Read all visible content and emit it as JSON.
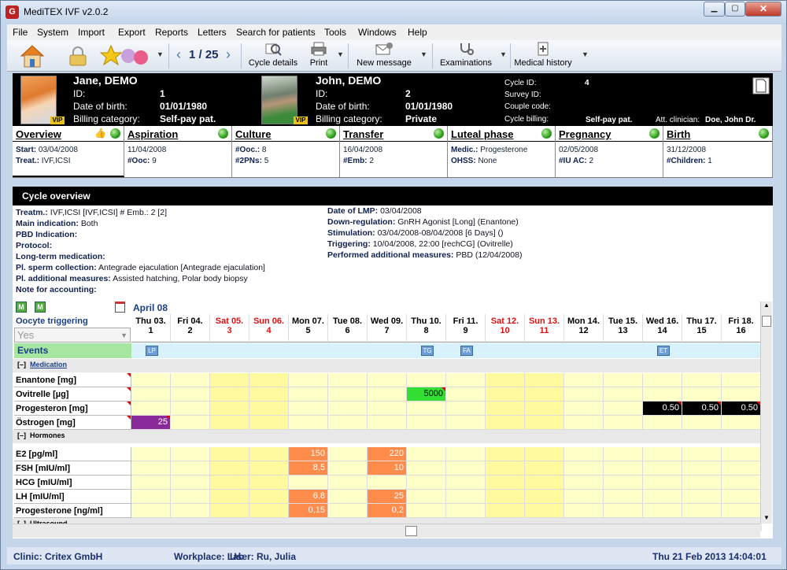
{
  "window": {
    "title": "MediTEX IVF v2.0.2",
    "app_icon_glyph": "G"
  },
  "menu": [
    "File",
    "System",
    "Import",
    "Export",
    "Reports",
    "Letters",
    "Search for patients",
    "Tools",
    "Windows",
    "Help"
  ],
  "toolbar": {
    "counter": "1 / 25",
    "cycle_details": "Cycle details",
    "print": "Print",
    "new_message": "New message",
    "examinations": "Examinations",
    "medical_history": "Medical history"
  },
  "patient": {
    "female": {
      "name": "Jane, DEMO",
      "id_label": "ID:",
      "id": "1",
      "dob_label": "Date of birth:",
      "dob": "01/01/1980",
      "billing_label": "Billing category:",
      "billing": "Self-pay pat.",
      "badge": "VIP"
    },
    "male": {
      "name": "John, DEMO",
      "id_label": "ID:",
      "id": "2",
      "dob_label": "Date of birth:",
      "dob": "01/01/1980",
      "billing_label": "Billing category:",
      "billing": "Private",
      "badge": "VIP"
    },
    "cycle_id_label": "Cycle ID:",
    "cycle_id": "4",
    "survey_id_label": "Survey ID:",
    "couple_code_label": "Couple code:",
    "cycle_billing_label": "Cycle billing:",
    "cycle_billing": "Self-pay pat.",
    "att_clinician_label": "Att. clinician:",
    "att_clinician": "Doe, John Dr."
  },
  "tabs": [
    {
      "title": "Overview",
      "l1k": "Start:",
      "l1v": "03/04/2008",
      "l2k": "Treat.:",
      "l2v": "IVF,ICSI"
    },
    {
      "title": "Aspiration",
      "l1k": "",
      "l1v": "11/04/2008",
      "l2k": "#Ooc:",
      "l2v": "9"
    },
    {
      "title": "Culture",
      "l1k": "#Ooc.:",
      "l1v": "8",
      "l2k": "#2PNs:",
      "l2v": "5"
    },
    {
      "title": "Transfer",
      "l1k": "",
      "l1v": "16/04/2008",
      "l2k": "#Emb:",
      "l2v": "2"
    },
    {
      "title": "Luteal phase",
      "l1k": "Medic.:",
      "l1v": "Progesterone",
      "l2k": "OHSS:",
      "l2v": "None"
    },
    {
      "title": "Pregnancy",
      "l1k": "",
      "l1v": "02/05/2008",
      "l2k": "#IU AC:",
      "l2v": "2"
    },
    {
      "title": "Birth",
      "l1k": "",
      "l1v": "31/12/2008",
      "l2k": "#Children:",
      "l2v": "1"
    }
  ],
  "cycle_overview": {
    "title": "Cycle overview",
    "left": [
      {
        "k": "Treatm.:",
        "v": "IVF,ICSI     [IVF,ICSI]      # Emb.:  2     [2]"
      },
      {
        "k": "Main indication:",
        "v": "Both"
      },
      {
        "k": "PBD Indication:",
        "v": ""
      },
      {
        "k": "Protocol:",
        "v": ""
      },
      {
        "k": "Long-term medication:",
        "v": ""
      },
      {
        "k": "Pl. sperm collection:",
        "v": "Antegrade ejaculation       [Antegrade ejaculation]"
      },
      {
        "k": "Pl. additional measures:",
        "v": "Assisted hatching, Polar body biopsy"
      },
      {
        "k": "Note for accounting:",
        "v": ""
      }
    ],
    "right": [
      {
        "k": "Date of LMP:",
        "v": "03/04/2008"
      },
      {
        "k": "Down-regulation:",
        "v": "GnRH Agonist [Long] (Enantone)"
      },
      {
        "k": "Stimulation:",
        "v": "03/04/2008-08/04/2008 [6 Days]  ()"
      },
      {
        "k": "Triggering:",
        "v": "10/04/2008, 22:00  [rechCG] (Ovitrelle)"
      },
      {
        "k": "Performed additional measures:",
        "v": "PBD (12/04/2008)"
      }
    ]
  },
  "calendar": {
    "month": "April 08",
    "oocyte_triggering_label": "Oocyte triggering",
    "oocyte_triggering_value": "Yes",
    "events_label": "Events",
    "days": [
      {
        "d": "Thu 03.",
        "n": "1",
        "we": false
      },
      {
        "d": "Fri 04.",
        "n": "2",
        "we": false
      },
      {
        "d": "Sat 05.",
        "n": "3",
        "we": true
      },
      {
        "d": "Sun 06.",
        "n": "4",
        "we": true
      },
      {
        "d": "Mon 07.",
        "n": "5",
        "we": false
      },
      {
        "d": "Tue 08.",
        "n": "6",
        "we": false
      },
      {
        "d": "Wed 09.",
        "n": "7",
        "we": false
      },
      {
        "d": "Thu 10.",
        "n": "8",
        "we": false
      },
      {
        "d": "Fri 11.",
        "n": "9",
        "we": false
      },
      {
        "d": "Sat 12.",
        "n": "10",
        "we": true
      },
      {
        "d": "Sun 13.",
        "n": "11",
        "we": true
      },
      {
        "d": "Mon 14.",
        "n": "12",
        "we": false
      },
      {
        "d": "Tue 15.",
        "n": "13",
        "we": false
      },
      {
        "d": "Wed 16.",
        "n": "14",
        "we": false
      },
      {
        "d": "Thu 17.",
        "n": "15",
        "we": false
      },
      {
        "d": "Fri 18.",
        "n": "16",
        "we": false
      }
    ],
    "events": [
      {
        "col": 0,
        "tag": "LP"
      },
      {
        "col": 7,
        "tag": "TG"
      },
      {
        "col": 8,
        "tag": "FA"
      },
      {
        "col": 13,
        "tag": "ET"
      }
    ],
    "medication_section": "Medication",
    "medication_rows": [
      {
        "label": "Enantone [mg]",
        "cells": []
      },
      {
        "label": "Ovitrelle [µg]",
        "cells": [
          {
            "col": 7,
            "v": "5000",
            "style": "green"
          }
        ]
      },
      {
        "label": "Progesteron [mg]",
        "cells": [
          {
            "col": 13,
            "v": "0.50",
            "style": "black"
          },
          {
            "col": 14,
            "v": "0.50",
            "style": "black"
          },
          {
            "col": 15,
            "v": "0.50",
            "style": "black"
          }
        ]
      },
      {
        "label": "Östrogen [mg]",
        "cells": [
          {
            "col": 0,
            "v": "25",
            "style": "purple"
          }
        ]
      }
    ],
    "hormones_section": "Hormones",
    "hormone_rows": [
      {
        "label": "E2  [pg/ml]",
        "cells": [
          {
            "col": 4,
            "v": "150"
          },
          {
            "col": 6,
            "v": "220"
          }
        ]
      },
      {
        "label": "FSH  [mIU/ml]",
        "cells": [
          {
            "col": 4,
            "v": "8,5"
          },
          {
            "col": 6,
            "v": "10"
          }
        ]
      },
      {
        "label": "HCG  [mIU/ml]",
        "cells": []
      },
      {
        "label": "LH  [mIU/ml]",
        "cells": [
          {
            "col": 4,
            "v": "6,8"
          },
          {
            "col": 6,
            "v": "25"
          }
        ]
      },
      {
        "label": "Progesterone  [ng/ml]",
        "cells": [
          {
            "col": 4,
            "v": "0,15"
          },
          {
            "col": 6,
            "v": "0,2"
          }
        ]
      }
    ],
    "ultrasound_section": "Ultrasound"
  },
  "status": {
    "clinic": "Clinic: Critex GmbH",
    "workplace": "Workplace: Lab",
    "user": "User: Ru, Julia",
    "datetime": "Thu 21 Feb 2013 14:04:01"
  },
  "colors": {
    "yellow": "#ffffc8",
    "weekend": "#fffa9e",
    "orange": "#ff8c4a",
    "green": "#33dd33",
    "purple": "#8a2a9a",
    "event_bg": "#d8f2fb",
    "events_row_label": "#a6e6a0"
  }
}
